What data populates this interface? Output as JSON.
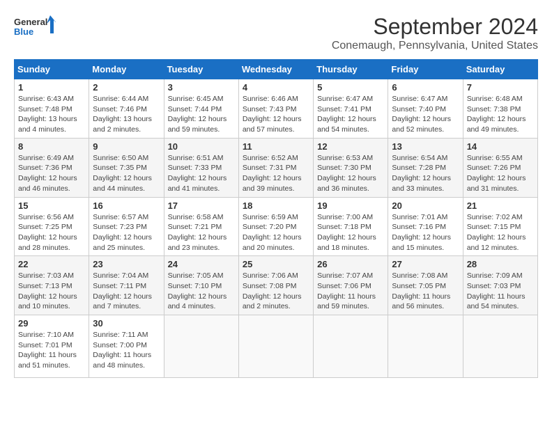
{
  "logo": {
    "line1": "General",
    "line2": "Blue"
  },
  "title": "September 2024",
  "subtitle": "Conemaugh, Pennsylvania, United States",
  "weekdays": [
    "Sunday",
    "Monday",
    "Tuesday",
    "Wednesday",
    "Thursday",
    "Friday",
    "Saturday"
  ],
  "weeks": [
    [
      {
        "day": "1",
        "sunrise": "6:43 AM",
        "sunset": "7:48 PM",
        "daylight": "13 hours and 4 minutes."
      },
      {
        "day": "2",
        "sunrise": "6:44 AM",
        "sunset": "7:46 PM",
        "daylight": "13 hours and 2 minutes."
      },
      {
        "day": "3",
        "sunrise": "6:45 AM",
        "sunset": "7:44 PM",
        "daylight": "12 hours and 59 minutes."
      },
      {
        "day": "4",
        "sunrise": "6:46 AM",
        "sunset": "7:43 PM",
        "daylight": "12 hours and 57 minutes."
      },
      {
        "day": "5",
        "sunrise": "6:47 AM",
        "sunset": "7:41 PM",
        "daylight": "12 hours and 54 minutes."
      },
      {
        "day": "6",
        "sunrise": "6:47 AM",
        "sunset": "7:40 PM",
        "daylight": "12 hours and 52 minutes."
      },
      {
        "day": "7",
        "sunrise": "6:48 AM",
        "sunset": "7:38 PM",
        "daylight": "12 hours and 49 minutes."
      }
    ],
    [
      {
        "day": "8",
        "sunrise": "6:49 AM",
        "sunset": "7:36 PM",
        "daylight": "12 hours and 46 minutes."
      },
      {
        "day": "9",
        "sunrise": "6:50 AM",
        "sunset": "7:35 PM",
        "daylight": "12 hours and 44 minutes."
      },
      {
        "day": "10",
        "sunrise": "6:51 AM",
        "sunset": "7:33 PM",
        "daylight": "12 hours and 41 minutes."
      },
      {
        "day": "11",
        "sunrise": "6:52 AM",
        "sunset": "7:31 PM",
        "daylight": "12 hours and 39 minutes."
      },
      {
        "day": "12",
        "sunrise": "6:53 AM",
        "sunset": "7:30 PM",
        "daylight": "12 hours and 36 minutes."
      },
      {
        "day": "13",
        "sunrise": "6:54 AM",
        "sunset": "7:28 PM",
        "daylight": "12 hours and 33 minutes."
      },
      {
        "day": "14",
        "sunrise": "6:55 AM",
        "sunset": "7:26 PM",
        "daylight": "12 hours and 31 minutes."
      }
    ],
    [
      {
        "day": "15",
        "sunrise": "6:56 AM",
        "sunset": "7:25 PM",
        "daylight": "12 hours and 28 minutes."
      },
      {
        "day": "16",
        "sunrise": "6:57 AM",
        "sunset": "7:23 PM",
        "daylight": "12 hours and 25 minutes."
      },
      {
        "day": "17",
        "sunrise": "6:58 AM",
        "sunset": "7:21 PM",
        "daylight": "12 hours and 23 minutes."
      },
      {
        "day": "18",
        "sunrise": "6:59 AM",
        "sunset": "7:20 PM",
        "daylight": "12 hours and 20 minutes."
      },
      {
        "day": "19",
        "sunrise": "7:00 AM",
        "sunset": "7:18 PM",
        "daylight": "12 hours and 18 minutes."
      },
      {
        "day": "20",
        "sunrise": "7:01 AM",
        "sunset": "7:16 PM",
        "daylight": "12 hours and 15 minutes."
      },
      {
        "day": "21",
        "sunrise": "7:02 AM",
        "sunset": "7:15 PM",
        "daylight": "12 hours and 12 minutes."
      }
    ],
    [
      {
        "day": "22",
        "sunrise": "7:03 AM",
        "sunset": "7:13 PM",
        "daylight": "12 hours and 10 minutes."
      },
      {
        "day": "23",
        "sunrise": "7:04 AM",
        "sunset": "7:11 PM",
        "daylight": "12 hours and 7 minutes."
      },
      {
        "day": "24",
        "sunrise": "7:05 AM",
        "sunset": "7:10 PM",
        "daylight": "12 hours and 4 minutes."
      },
      {
        "day": "25",
        "sunrise": "7:06 AM",
        "sunset": "7:08 PM",
        "daylight": "12 hours and 2 minutes."
      },
      {
        "day": "26",
        "sunrise": "7:07 AM",
        "sunset": "7:06 PM",
        "daylight": "11 hours and 59 minutes."
      },
      {
        "day": "27",
        "sunrise": "7:08 AM",
        "sunset": "7:05 PM",
        "daylight": "11 hours and 56 minutes."
      },
      {
        "day": "28",
        "sunrise": "7:09 AM",
        "sunset": "7:03 PM",
        "daylight": "11 hours and 54 minutes."
      }
    ],
    [
      {
        "day": "29",
        "sunrise": "7:10 AM",
        "sunset": "7:01 PM",
        "daylight": "11 hours and 51 minutes."
      },
      {
        "day": "30",
        "sunrise": "7:11 AM",
        "sunset": "7:00 PM",
        "daylight": "11 hours and 48 minutes."
      },
      null,
      null,
      null,
      null,
      null
    ]
  ],
  "labels": {
    "sunrise": "Sunrise:",
    "sunset": "Sunset:",
    "daylight": "Daylight:"
  }
}
